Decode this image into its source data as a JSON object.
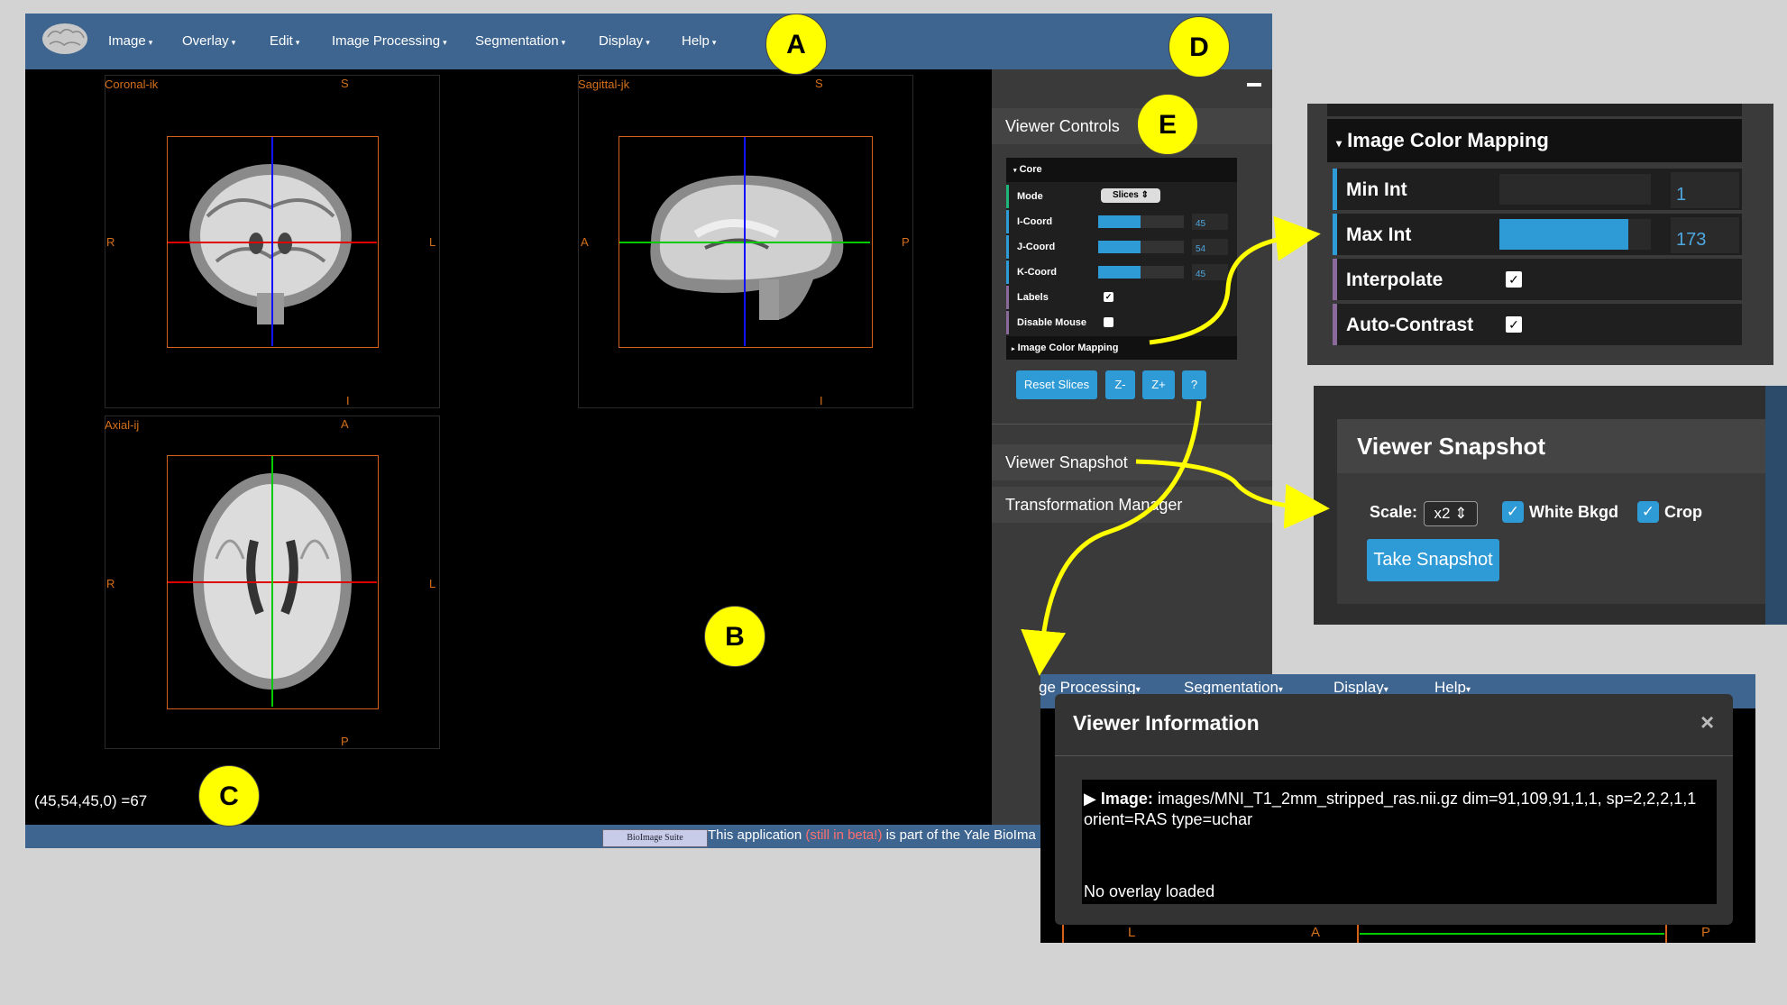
{
  "menubar": {
    "items": [
      "Image",
      "Overlay",
      "Edit",
      "Image Processing",
      "Segmentation",
      "Display",
      "Help"
    ]
  },
  "views": {
    "coronal": {
      "label": "Coronal-ik",
      "top": "S",
      "bottom": "I",
      "left": "R",
      "right": "L"
    },
    "sagittal": {
      "label": "Sagittal-jk",
      "top": "S",
      "bottom": "I",
      "left": "A",
      "right": "P"
    },
    "axial": {
      "label": "Axial-ij",
      "top": "A",
      "bottom": "P",
      "left": "R",
      "right": "L"
    }
  },
  "status": {
    "coord_readout": "(45,54,45,0) =67"
  },
  "footer": {
    "logo_text": "BioImage Suite",
    "text_a": "This application ",
    "text_beta": "(still in beta!)",
    "text_b": " is part of the Yale BioIma"
  },
  "sidepanel": {
    "minimize": "—",
    "viewer_controls": "Viewer Controls",
    "core_title": "Core",
    "mode_label": "Mode",
    "mode_value": "Slices",
    "i_label": "I-Coord",
    "i_value": "45",
    "j_label": "J-Coord",
    "j_value": "54",
    "k_label": "K-Coord",
    "k_value": "45",
    "labels_label": "Labels",
    "disable_mouse_label": "Disable Mouse",
    "color_mapping": "Image Color Mapping",
    "reset_slices": "Reset Slices",
    "z_minus": "Z-",
    "z_plus": "Z+",
    "help": "?",
    "viewer_snapshot": "Viewer Snapshot",
    "transformation_manager": "Transformation Manager"
  },
  "inset_color_mapping": {
    "title": "Image Color Mapping",
    "min_int_label": "Min Int",
    "min_int_value": "1",
    "max_int_label": "Max Int",
    "max_int_value": "173",
    "max_int_fraction": 0.85,
    "interpolate_label": "Interpolate",
    "auto_contrast_label": "Auto-Contrast"
  },
  "inset_snapshot": {
    "title": "Viewer Snapshot",
    "scale_label": "Scale:",
    "scale_value": "x2",
    "white_bkgd": "White Bkgd",
    "crop": "Crop",
    "take_snapshot": "Take Snapshot"
  },
  "inset_info": {
    "menu_fragment": [
      "ge Processing",
      "Segmentation",
      "Display",
      "Help"
    ],
    "title": "Viewer Information",
    "close": "×",
    "image_label": "Image:",
    "image_text": "images/MNI_T1_2mm_stripped_ras.nii.gz dim=91,109,91,1,1, sp=2,2,2,1,1",
    "orient_text": "orient=RAS type=uchar",
    "overlay_text": "No overlay loaded",
    "bottom_labels": [
      "L",
      "A",
      "P"
    ]
  },
  "callouts": [
    "A",
    "B",
    "C",
    "D",
    "E"
  ],
  "colors": {
    "accent": "#2e9ad6",
    "menubar": "#3d6590",
    "orange": "#d4601a",
    "callout": "#ffff00"
  }
}
